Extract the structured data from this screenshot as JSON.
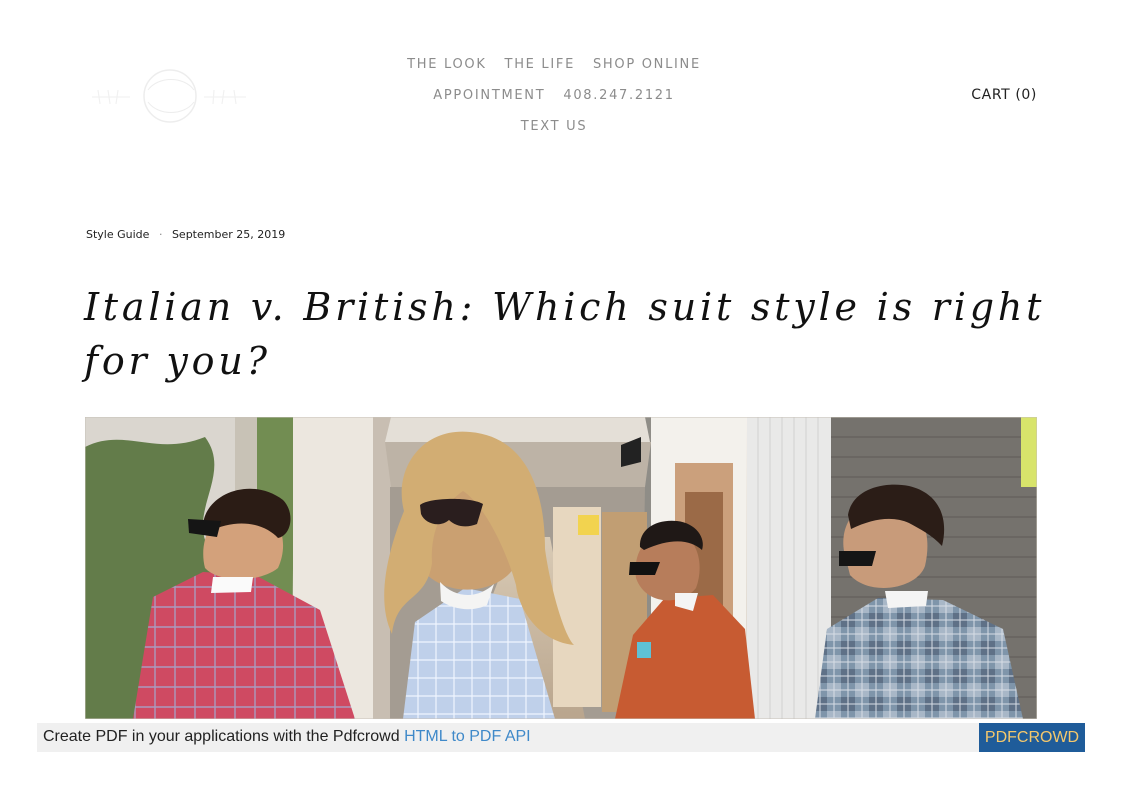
{
  "header": {
    "nav_rows": [
      [
        "THE LOOK",
        "THE LIFE",
        "SHOP ONLINE"
      ],
      [
        "APPOINTMENT",
        "408.247.2121"
      ],
      [
        "TEXT US"
      ]
    ],
    "cart_label": "CART (0)"
  },
  "post": {
    "category": "Style Guide",
    "separator": "·",
    "date": "September 25, 2019",
    "title": "Italian v. British: Which suit style is right for you?"
  },
  "banner": {
    "text": "Create PDF in your applications with the Pdfcrowd",
    "link_text": "HTML to PDF API",
    "button_label": "PDFCROWD"
  },
  "colors": {
    "nav_text": "#8c8c8c",
    "body_text": "#111111",
    "banner_bg": "#f0f0f0",
    "banner_link": "#3f89c9",
    "button_bg": "#1f5c9a",
    "button_text": "#f5c86c"
  },
  "icons": {
    "logo": "faint-brand-logo"
  }
}
